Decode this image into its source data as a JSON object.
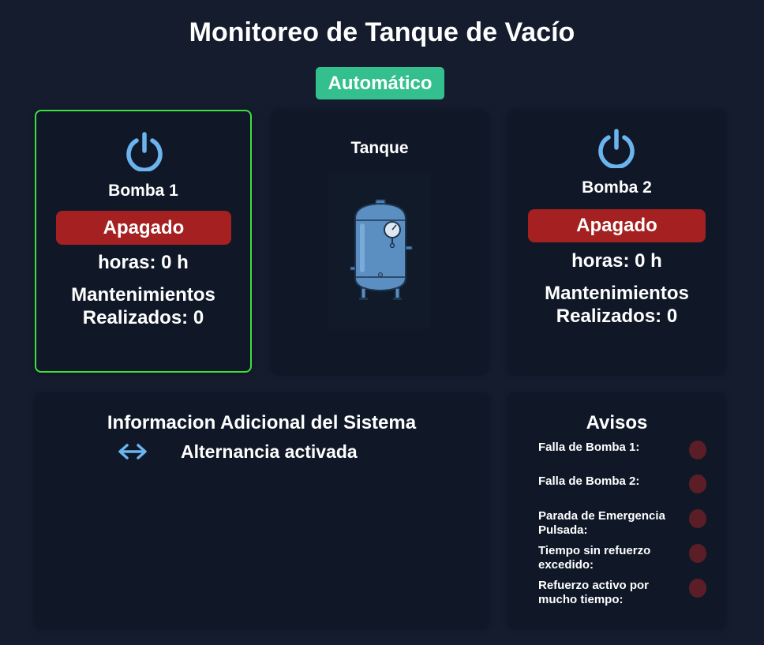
{
  "header": {
    "title": "Monitoreo de Tanque de Vacío",
    "mode": "Automático"
  },
  "colors": {
    "background": "#141c2e",
    "card": "#101828",
    "mode_badge": "#34c08e",
    "state_off": "#a52020",
    "active_border": "#3ee03e",
    "icon_blue": "#6cb4f0",
    "led_off": "#5c1e26"
  },
  "pumps": [
    {
      "name": "Bomba 1",
      "icon": "power-icon",
      "state": "Apagado",
      "hours": "horas: 0 h",
      "maintenance_line1": "Mantenimientos",
      "maintenance_line2": "Realizados: 0",
      "selected": true
    },
    {
      "name": "Bomba 2",
      "icon": "power-icon",
      "state": "Apagado",
      "hours": "horas: 0 h",
      "maintenance_line1": "Mantenimientos",
      "maintenance_line2": "Realizados: 0",
      "selected": false
    }
  ],
  "tank": {
    "label": "Tanque",
    "icon": "vacuum-tank-icon"
  },
  "info": {
    "title": "Informacion Adicional del Sistema",
    "alternation_icon": "left-right-arrow-icon",
    "alternation_text": "Alternancia activada"
  },
  "avisos": {
    "title": "Avisos",
    "items": [
      {
        "label": "Falla de Bomba 1:",
        "active": false
      },
      {
        "label": "Falla de Bomba 2:",
        "active": false
      },
      {
        "label": "Parada de Emergencia Pulsada:",
        "active": false
      },
      {
        "label": "Tiempo sin refuerzo excedido:",
        "active": false
      },
      {
        "label": "Refuerzo activo por mucho tiempo:",
        "active": false
      }
    ]
  }
}
